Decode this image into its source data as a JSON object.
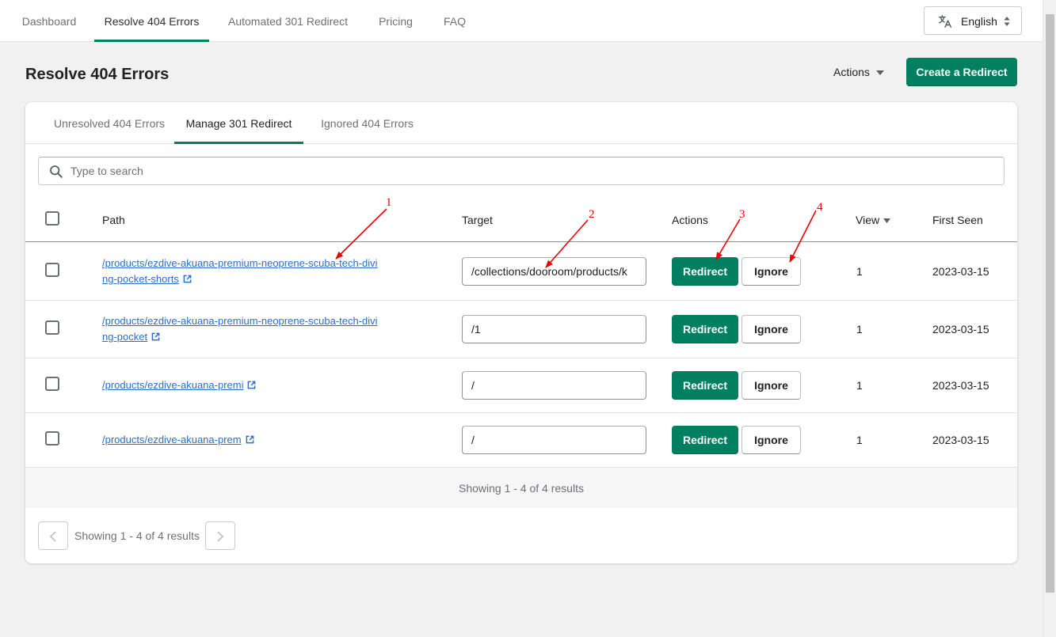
{
  "nav": {
    "tabs": [
      {
        "label": "Dashboard",
        "active": false
      },
      {
        "label": "Resolve 404 Errors",
        "active": true
      },
      {
        "label": "Automated 301 Redirect",
        "active": false
      },
      {
        "label": "Pricing",
        "active": false
      },
      {
        "label": "FAQ",
        "active": false
      }
    ],
    "language": "English"
  },
  "page": {
    "title": "Resolve 404 Errors",
    "actions_label": "Actions",
    "create_label": "Create a Redirect"
  },
  "subtabs": [
    {
      "label": "Unresolved 404 Errors",
      "active": false
    },
    {
      "label": "Manage 301 Redirect",
      "active": true
    },
    {
      "label": "Ignored 404 Errors",
      "active": false
    }
  ],
  "search": {
    "placeholder": "Type to search",
    "value": ""
  },
  "table": {
    "headers": {
      "path": "Path",
      "target": "Target",
      "actions": "Actions",
      "view": "View",
      "first_seen": "First Seen"
    },
    "redirect_label": "Redirect",
    "ignore_label": "Ignore",
    "rows": [
      {
        "path": "/products/ezdive-akuana-premium-neoprene-scuba-tech-diving-pocket-shorts",
        "target": "/collections/dooroom/products/k",
        "view": "1",
        "first_seen": "2023-03-15"
      },
      {
        "path": "/products/ezdive-akuana-premium-neoprene-scuba-tech-diving-pocket",
        "target": "/1",
        "view": "1",
        "first_seen": "2023-03-15"
      },
      {
        "path": "/products/ezdive-akuana-premi",
        "target": "/",
        "view": "1",
        "first_seen": "2023-03-15"
      },
      {
        "path": "/products/ezdive-akuana-prem",
        "target": "/",
        "view": "1",
        "first_seen": "2023-03-15"
      }
    ],
    "footer_text": "Showing 1 - 4 of 4 results"
  },
  "pagination": {
    "text": "Showing 1 - 4 of 4 results"
  },
  "annotations": [
    "1",
    "2",
    "3",
    "4"
  ],
  "colors": {
    "accent": "#008060",
    "link": "#2c6ecb",
    "annotation": "#ee0000"
  }
}
